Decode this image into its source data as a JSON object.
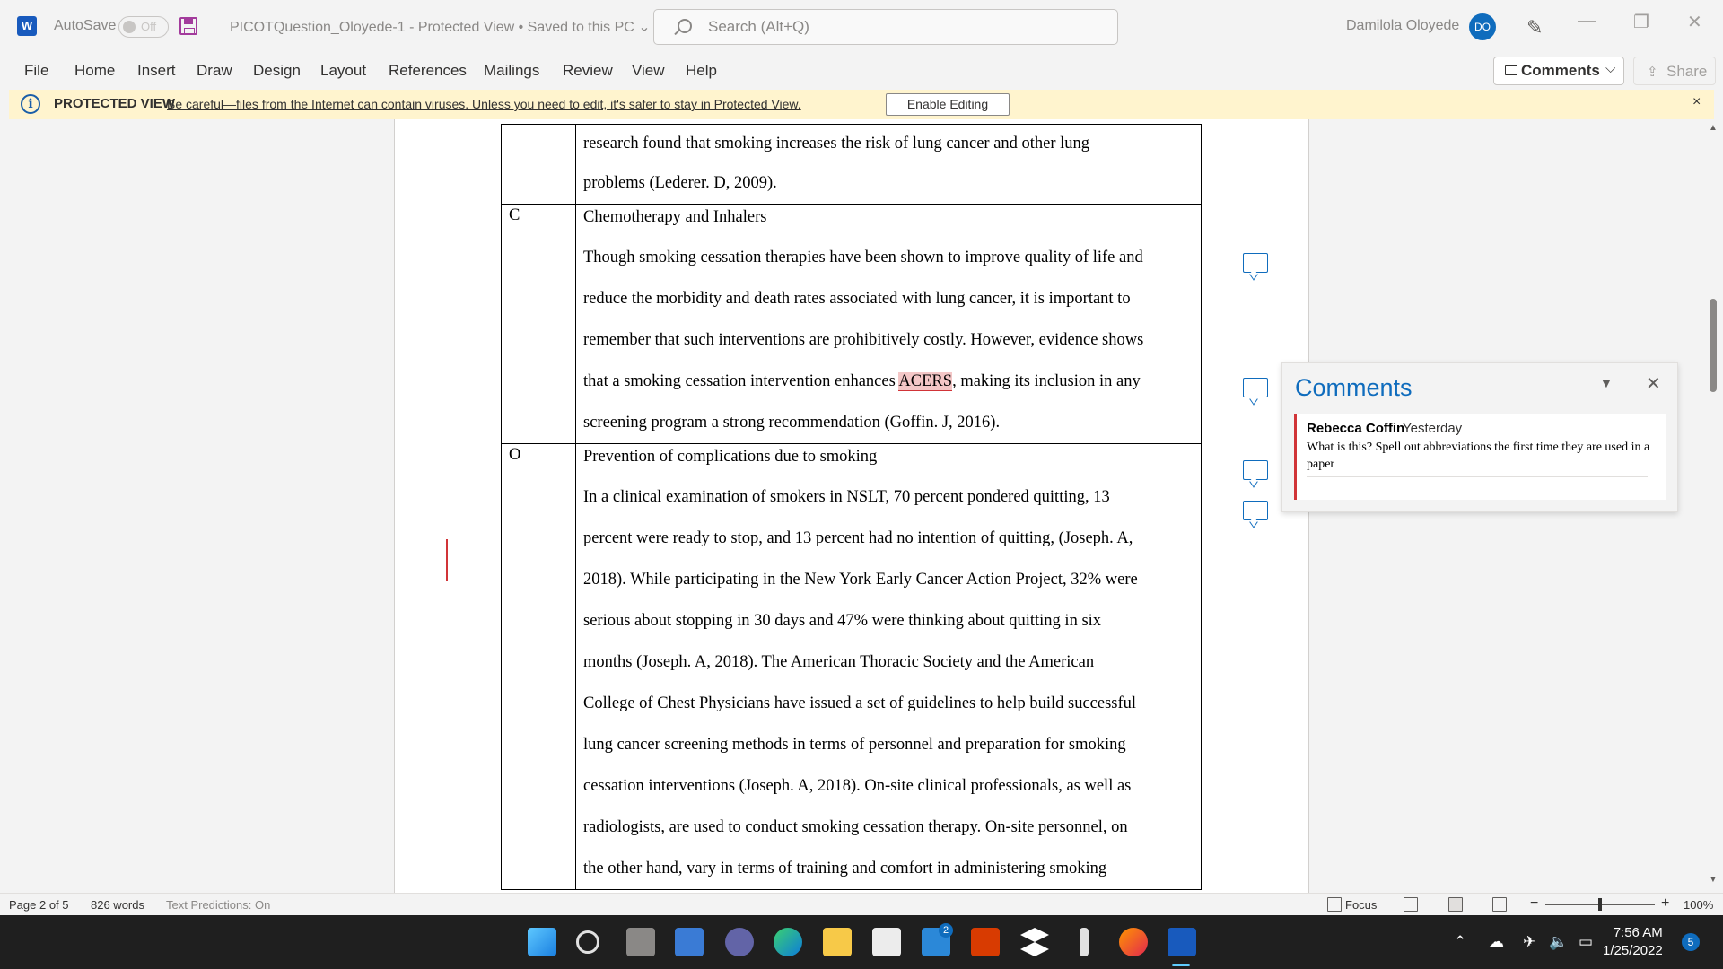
{
  "titlebar": {
    "app_logo": "W",
    "autosave_label": "AutoSave",
    "autosave_state": "Off",
    "doc_title": "PICOTQuestion_Oloyede-1  -  Protected View • Saved to this PC  ⌄",
    "search_placeholder": "Search (Alt+Q)",
    "user_name": "Damilola  Oloyede",
    "avatar_initials": "DO",
    "minimize": "—",
    "restore": "❐",
    "close": "✕"
  },
  "menu": {
    "items": [
      "File",
      "Home",
      "Insert",
      "Draw",
      "Design",
      "Layout",
      "References",
      "Mailings",
      "Review",
      "View",
      "Help"
    ],
    "comments_label": "Comments",
    "share_label": "Share"
  },
  "protected_view": {
    "title": "PROTECTED VIEW",
    "message": "Be careful—files from the Internet can contain viruses. Unless you need to edit, it's safer to stay in Protected View.",
    "enable_button": "Enable Editing",
    "close": "×"
  },
  "document": {
    "row1": {
      "letter": "",
      "lines": [
        "research found that smoking increases the risk of lung cancer and other lung",
        "problems (Lederer. D, 2009)."
      ]
    },
    "row2": {
      "letter": "C",
      "heading": "Chemotherapy and Inhalers",
      "lines": [
        "Though smoking cessation therapies have been shown to improve quality of life and",
        "reduce the morbidity and death rates associated with lung cancer, it is important to",
        "remember that such interventions are prohibitively costly. However, evidence shows"
      ],
      "line4_before": "that a smoking cessation intervention enhances ",
      "line4_highlight": "ACERS",
      "line4_after": ", making its inclusion in any",
      "line5": "screening program a strong recommendation (Goffin. J, 2016)."
    },
    "row3": {
      "letter": "O",
      "heading": "Prevention of complications due to smoking",
      "lines": [
        "In a clinical examination of smokers in NSLT, 70 percent pondered quitting, 13",
        "percent were ready to stop, and 13 percent had no intention of quitting, (Joseph. A,",
        "2018). While participating in the New York Early Cancer Action Project, 32% were",
        "serious about stopping in 30 days and 47% were thinking about quitting in six",
        "months (Joseph. A, 2018). The American Thoracic Society and the American",
        "College of Chest Physicians have issued a set of guidelines to help build successful",
        "lung cancer screening methods in terms of personnel and preparation for smoking",
        "cessation interventions (Joseph. A, 2018). On-site clinical professionals, as well as",
        "radiologists, are used to conduct smoking cessation therapy. On-site personnel, on",
        "the other hand, vary in terms of training and comfort in administering smoking"
      ]
    }
  },
  "comments_pane": {
    "title": "Comments",
    "chevron": "▼",
    "close": "✕",
    "comment": {
      "author": "Rebecca Coffin",
      "time": "Yesterday",
      "text": "What is this? Spell out abbreviations the first time they are used in a paper"
    }
  },
  "statusbar": {
    "page": "Page 2 of 5",
    "words": "826 words",
    "predictions": "Text Predictions: On",
    "focus": "Focus",
    "zoom_minus": "−",
    "zoom_plus": "+",
    "zoom": "100%"
  },
  "taskbar": {
    "mail_badge": "2",
    "time": "7:56 AM",
    "date": "1/25/2022",
    "notifications": "5"
  },
  "colors": {
    "accent": "#0f6cbd",
    "word_blue": "#185abd",
    "protected_bar": "#fff4ce",
    "comment_highlight": "#f4c7c7",
    "comment_border": "#d13438"
  }
}
